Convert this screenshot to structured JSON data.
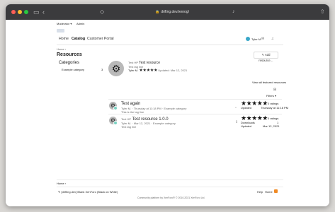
{
  "browser": {
    "url": "driftng.dev/xenog/",
    "sidebar_icon": "sidebar-icon",
    "back_icon": "back-arrow-icon",
    "shield_icon": "shield-icon",
    "mic_icon": "microphone-icon",
    "share_icon": "share-icon"
  },
  "topnav": {
    "links": [
      "Moderator ▾",
      "Admin"
    ]
  },
  "nav": {
    "tabs": [
      "Home",
      "Catalog",
      "Customer Portal"
    ],
    "active": "Catalog",
    "user": "Tyler M.",
    "user_color": "#39a7c9"
  },
  "breadcrumb": "Home ›",
  "page_title": "Resources",
  "add_resource": "Add resource…",
  "categories": {
    "title": "Categories",
    "items": [
      {
        "name": "Example category",
        "count": "3"
      }
    ]
  },
  "featured": {
    "prefix": "Test HP",
    "title": "Test resource",
    "tagline": "Test tag line",
    "author": "Tyler M.",
    "updated": "Updated: Mar 12, 2021",
    "rating_stars": "★★★★★",
    "view_all": "View all featured resources"
  },
  "filters": "Filters ▾",
  "resources": [
    {
      "title": "Test again",
      "meta": "Tyler M. · Thursday at 11:18 PM · Example category",
      "tagline": "This is the tag line",
      "stars": "★★★★★",
      "ratings": "0 ratings",
      "stat_label": "Updated",
      "stat_value": "Thursday at 11:18 PM"
    },
    {
      "title": "Test resource 1.0.0",
      "prefix": "Test HP",
      "meta": "Tyler M. · Mar 12, 2021 · Example category",
      "tagline": "Test tag line",
      "stars": "★★★★★",
      "ratings": "0 ratings",
      "downloads_label": "Downloads",
      "downloads": "1",
      "stat_label": "Updated",
      "stat_value": "Mar 12, 2021"
    }
  ],
  "footer": {
    "breadcrumb": "Home ›",
    "style": "[drifting.dev] Blank XenForo (Black on White)",
    "links": [
      "Help",
      "Home"
    ],
    "copyright": "Community platform by XenForo® © 2010-2021 XenForo Ltd."
  },
  "colors": {
    "star": "#111111",
    "badge": "#7bd1c2",
    "rss": "#f08a24"
  }
}
